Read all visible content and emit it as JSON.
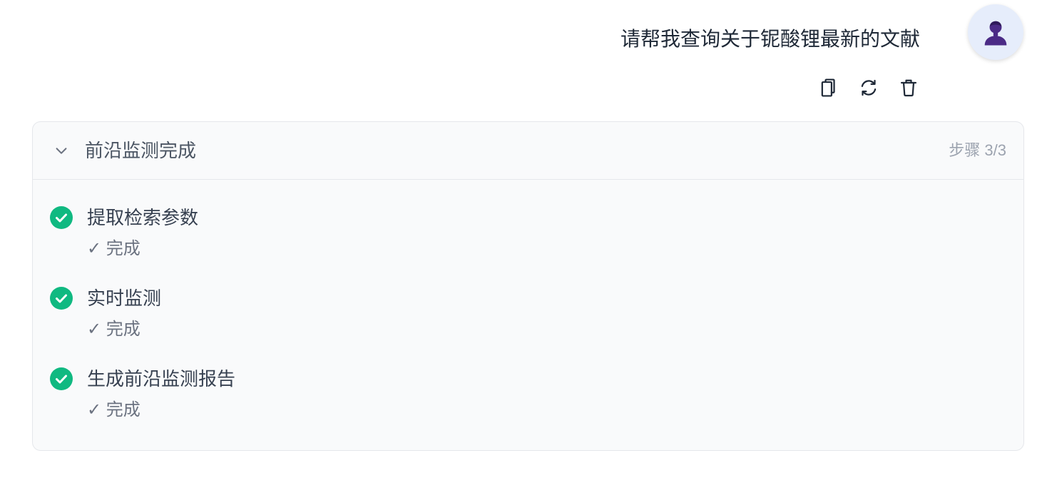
{
  "message": {
    "text": "请帮我查询关于铌酸锂最新的文献",
    "avatar_icon": "user-icon"
  },
  "actions": [
    {
      "icon": "copy-icon"
    },
    {
      "icon": "refresh-icon"
    },
    {
      "icon": "trash-icon"
    }
  ],
  "progress": {
    "toggle_icon": "chevron-down-icon",
    "title": "前沿监测完成",
    "step_label": "步骤 3/3",
    "steps": [
      {
        "icon": "check-circle-icon",
        "completed": true,
        "title": "提取检索参数",
        "status_text": "✓ 完成"
      },
      {
        "icon": "check-circle-icon",
        "completed": true,
        "title": "实时监测",
        "status_text": "✓ 完成"
      },
      {
        "icon": "check-circle-icon",
        "completed": true,
        "title": "生成前沿监测报告",
        "status_text": "✓ 完成"
      }
    ]
  },
  "colors": {
    "text": "#1f2937",
    "title": "#4b5563",
    "step_title": "#374151",
    "muted": "#6b7280",
    "faint": "#9ca3af",
    "accent_green": "#10b981",
    "card_bg": "#f9fafb",
    "border": "#e5e7eb",
    "avatar_bg": "#e6edfb",
    "avatar_icon": "#4b2b86"
  }
}
